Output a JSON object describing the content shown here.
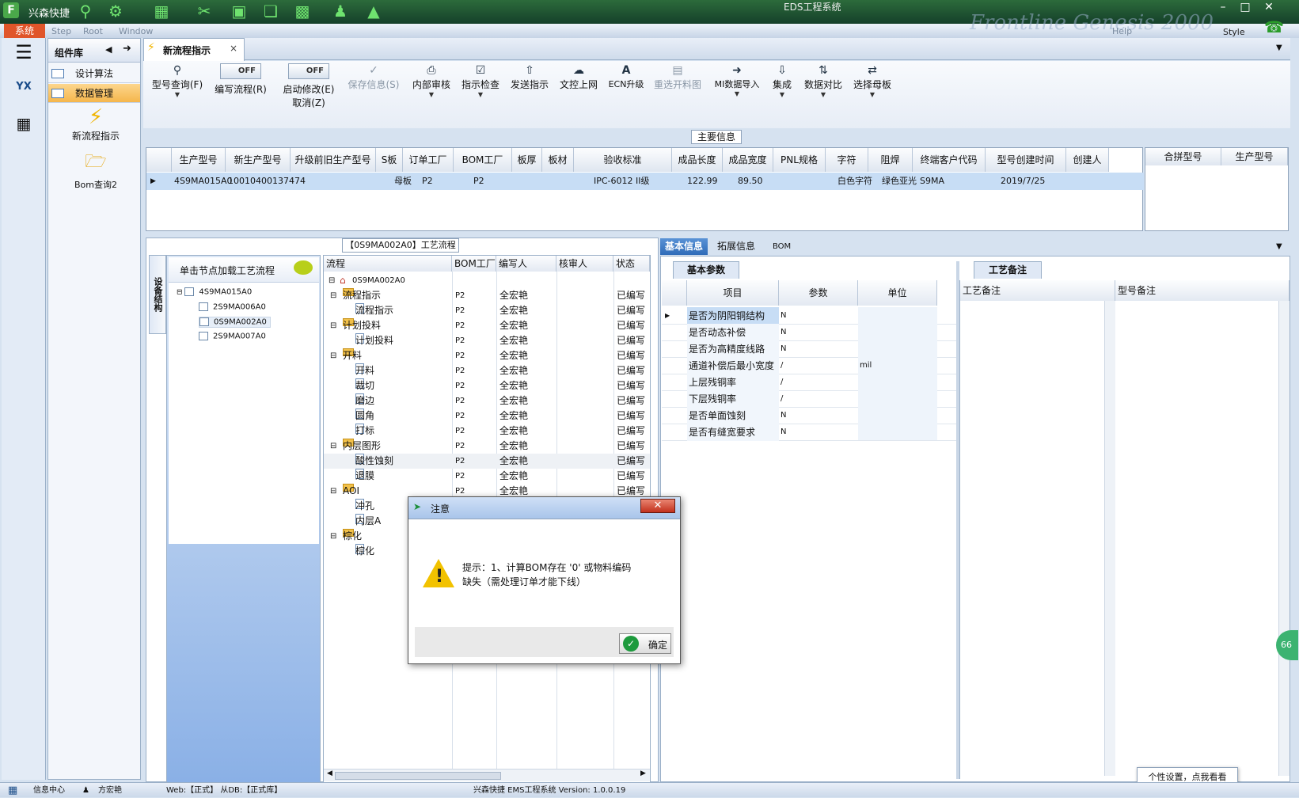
{
  "app": {
    "name": "兴森快捷",
    "window_title": "EDS工程系统",
    "style_label": "Style",
    "banner": "Frontline Genesis 2000"
  },
  "menu": {
    "system": "系统",
    "items": [
      "Step",
      "Root",
      "Window",
      "Help"
    ]
  },
  "component_panel": {
    "title": "组件库",
    "items": [
      {
        "label": "设计算法",
        "selected": false
      },
      {
        "label": "数据管理",
        "selected": true
      }
    ],
    "big_items": [
      "新流程指示",
      "Bom查询2"
    ]
  },
  "tab": {
    "label": "新流程指示",
    "close": "×"
  },
  "toolbar": {
    "type_query": "型号查询(F)",
    "edit_flow": "编写流程(R)",
    "edit_toggle": "OFF",
    "start_modify": "启动修改(E)",
    "start_toggle": "OFF",
    "cancel": "取消(Z)",
    "save_info": "保存信息(S)",
    "internal_review": "内部审核",
    "indicator_check": "指示检查",
    "send_indicator": "发送指示",
    "doc_upload": "文控上网",
    "ecn_upgrade": "ECN升级",
    "reselect_drawing": "重选开料图",
    "mi_import": "MI数据导入",
    "integrate": "集成",
    "data_compare": "数据对比",
    "select_mother": "选择母板"
  },
  "main_info": {
    "label": "主要信息",
    "columns": [
      "生产型号",
      "新生产型号",
      "升级前旧生产型号",
      "S板",
      "订单工厂",
      "BOM工厂",
      "板厚",
      "板材",
      "验收标准",
      "成品长度",
      "成品宽度",
      "PNL规格",
      "字符",
      "阻焊",
      "终端客户代码",
      "型号创建时间",
      "创建人"
    ],
    "row": [
      "4S9MA015A0",
      "10010400137474",
      "",
      "母板",
      "P2",
      "P2",
      "",
      "",
      "IPC-6012 II级",
      "122.99",
      "89.50",
      "",
      "白色字符",
      "绿色亚光",
      "S9MA",
      "2019/7/25",
      ""
    ],
    "merge_columns": [
      "合拼型号",
      "生产型号"
    ]
  },
  "flow": {
    "title": "【0S9MA002A0】工艺流程",
    "vert_tab": "设备结构",
    "tree_hint": "单击节点加载工艺流程",
    "tree": [
      {
        "label": "4S9MA015A0",
        "level": 0
      },
      {
        "label": "2S9MA006A0",
        "level": 1
      },
      {
        "label": "0S9MA002A0",
        "level": 1
      },
      {
        "label": "2S9MA007A0",
        "level": 1
      }
    ],
    "columns": [
      "流程",
      "BOM工厂",
      "编写人",
      "核审人",
      "状态"
    ],
    "root": "0S9MA002A0",
    "rows": [
      {
        "name": "流程指示",
        "level": 1,
        "folder": true,
        "bom": "P2",
        "writer": "全宏艳",
        "status": "已编写"
      },
      {
        "name": "流程指示",
        "level": 2,
        "folder": false,
        "bom": "P2",
        "writer": "全宏艳",
        "status": "已编写"
      },
      {
        "name": "计划投料",
        "level": 1,
        "folder": true,
        "bom": "P2",
        "writer": "全宏艳",
        "status": "已编写"
      },
      {
        "name": "计划投料",
        "level": 2,
        "folder": false,
        "bom": "P2",
        "writer": "全宏艳",
        "status": "已编写"
      },
      {
        "name": "开料",
        "level": 1,
        "folder": true,
        "bom": "P2",
        "writer": "全宏艳",
        "status": "已编写"
      },
      {
        "name": "开料",
        "level": 2,
        "folder": false,
        "bom": "P2",
        "writer": "全宏艳",
        "status": "已编写"
      },
      {
        "name": "裁切",
        "level": 2,
        "folder": false,
        "bom": "P2",
        "writer": "全宏艳",
        "status": "已编写"
      },
      {
        "name": "磨边",
        "level": 2,
        "folder": false,
        "bom": "P2",
        "writer": "全宏艳",
        "status": "已编写"
      },
      {
        "name": "圆角",
        "level": 2,
        "folder": false,
        "bom": "P2",
        "writer": "全宏艳",
        "status": "已编写"
      },
      {
        "name": "打标",
        "level": 2,
        "folder": false,
        "bom": "P2",
        "writer": "全宏艳",
        "status": "已编写"
      },
      {
        "name": "内层图形",
        "level": 1,
        "folder": true,
        "bom": "P2",
        "writer": "全宏艳",
        "status": "已编写"
      },
      {
        "name": "酸性蚀刻",
        "level": 2,
        "folder": false,
        "bom": "P2",
        "writer": "全宏艳",
        "status": "已编写"
      },
      {
        "name": "退膜",
        "level": 2,
        "folder": false,
        "bom": "P2",
        "writer": "全宏艳",
        "status": "已编写"
      },
      {
        "name": "AOI",
        "level": 1,
        "folder": true,
        "bom": "P2",
        "writer": "全宏艳",
        "status": "已编写"
      },
      {
        "name": "冲孔",
        "level": 2,
        "folder": false,
        "bom": "",
        "writer": "",
        "status": ""
      },
      {
        "name": "内层A",
        "level": 2,
        "folder": false,
        "bom": "",
        "writer": "",
        "status": ""
      },
      {
        "name": "棕化",
        "level": 1,
        "folder": true,
        "bom": "",
        "writer": "",
        "status": ""
      },
      {
        "name": "棕化",
        "level": 2,
        "folder": false,
        "bom": "",
        "writer": "",
        "status": ""
      }
    ]
  },
  "right": {
    "tabs": [
      "基本信息",
      "拓展信息",
      "BOM"
    ],
    "basic_tab": "基本参数",
    "note_tab": "工艺备注",
    "param_columns": [
      "项目",
      "参数",
      "单位"
    ],
    "params": [
      {
        "item": "是否为阴阳铜结构",
        "value": "N",
        "unit": ""
      },
      {
        "item": "是否动态补偿",
        "value": "N",
        "unit": ""
      },
      {
        "item": "是否为高精度线路",
        "value": "N",
        "unit": ""
      },
      {
        "item": "通道补偿后最小宽度",
        "value": "/",
        "unit": "mil"
      },
      {
        "item": "上层残铜率",
        "value": "/",
        "unit": ""
      },
      {
        "item": "下层残铜率",
        "value": "/",
        "unit": ""
      },
      {
        "item": "是否单面蚀刻",
        "value": "N",
        "unit": ""
      },
      {
        "item": "是否有缝宽要求",
        "value": "N",
        "unit": ""
      }
    ],
    "note_columns": [
      "工艺备注",
      "型号备注"
    ]
  },
  "dialog": {
    "title": "注意",
    "message_line1": "提示：1、计算BOM存在 '0' 或物料编码",
    "message_line2": "缺失（需处理订单才能下线）",
    "ok": "确定"
  },
  "tooltip": "个性设置，点我看看",
  "status": {
    "info_center": "信息中心",
    "user": "方宏艳",
    "env": "Web:【正式】 从DB:【正式库】",
    "version": "兴森快捷 EMS工程系统 Version: 1.0.0.19",
    "badge": "66"
  }
}
